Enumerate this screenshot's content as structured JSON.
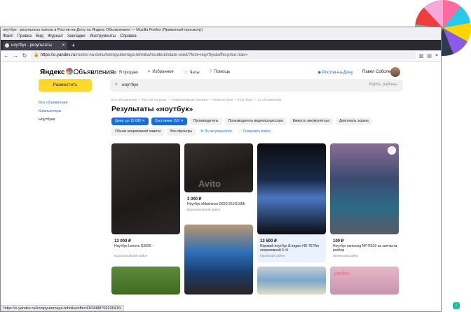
{
  "window": {
    "title": "ноутбук - результаты поиска в Ростов-на-Дону на Яндекс Объявлениях — Mozilla Firefox (Приватный просмотр)",
    "menu": [
      "Файл",
      "Правка",
      "Вид",
      "Журнал",
      "Закладки",
      "Инструменты",
      "Справка"
    ],
    "tab_label": "ноутбук - результаты",
    "url_host": "https://o.yandex.ru",
    "url_path": "/rostov-na-donu/kompyuternaya-tehnika/noutbuki/state-used/?text=ноутбук&offer.price.max="
  },
  "header": {
    "logo_a": "Яндекс",
    "logo_b": "Объявления",
    "links": [
      "Я продаю",
      "Избранное",
      "Чаты",
      "Помощь"
    ],
    "city": "Ростов-на-Дону",
    "user": "Павел Соболев"
  },
  "post_button": "Разместить",
  "search": {
    "query": "ноутбук",
    "location_placeholder": "Карта, районы"
  },
  "sidebar": {
    "all": "Все объявления",
    "computers": "Компьютеры",
    "notebooks": "Ноутбуки"
  },
  "breadcrumbs": "Все объявления — Ростов-на-Дону — Компьютерная техника — Компьютеры — Ноутбуки — 12 объявлений",
  "page_title": "Результаты «ноутбук»",
  "filters": {
    "price": "Цена: до 15 000 ✕",
    "state": "Состояние: Б/У ✕",
    "maker": "Производитель",
    "cpu": "Производитель видеопроцессора",
    "battery": "Емкость аккумулятора",
    "screen": "Диагональ экрана",
    "ram": "Объем оперативной памяти",
    "all": "Все фильтры",
    "sort": "По актуальности",
    "save": "Сохранить поиск"
  },
  "cards": [
    {
      "price": "13 000 ₽",
      "title": "Ноутбук Lenovo G5055 -",
      "place": "Ворошиловский район"
    },
    {
      "price": "3 000 ₽",
      "title": "Ноутбук eMachines D620-261G16Mi",
      "place": "Ворошиловский район"
    },
    {
      "price": "13 500 ₽",
      "title": "Игровой ноутбук i5 видео HD 7670m оперативной 6 гб",
      "place": "Кировский район"
    },
    {
      "price": "100 ₽",
      "title": "Ноутбук samsung NP-R519 на запчасти, разбор",
      "place": "Ленинский район"
    }
  ],
  "status_url": "https://o.yandex.ru/kompyuternaya-tehnika/offer/4169488706236416/",
  "watermark": "yandex"
}
